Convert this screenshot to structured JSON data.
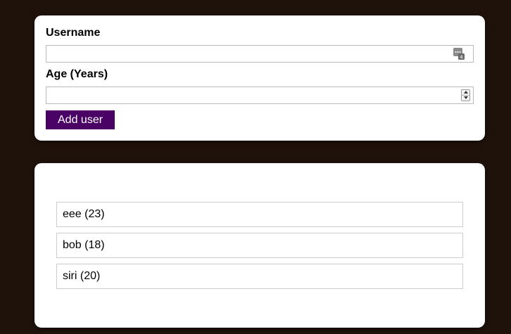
{
  "form": {
    "username_label": "Username",
    "username_value": "",
    "age_label": "Age (Years)",
    "age_value": "",
    "add_button_label": "Add user",
    "button_color": "#4a0265"
  },
  "users": [
    "eee (23)",
    "bob (18)",
    "siri (20)"
  ],
  "icons": {
    "username_field_icon": "password-manager-icon",
    "age_field_control": "number-spinner"
  },
  "colors": {
    "background": "#1f120a",
    "card": "#ffffff"
  }
}
